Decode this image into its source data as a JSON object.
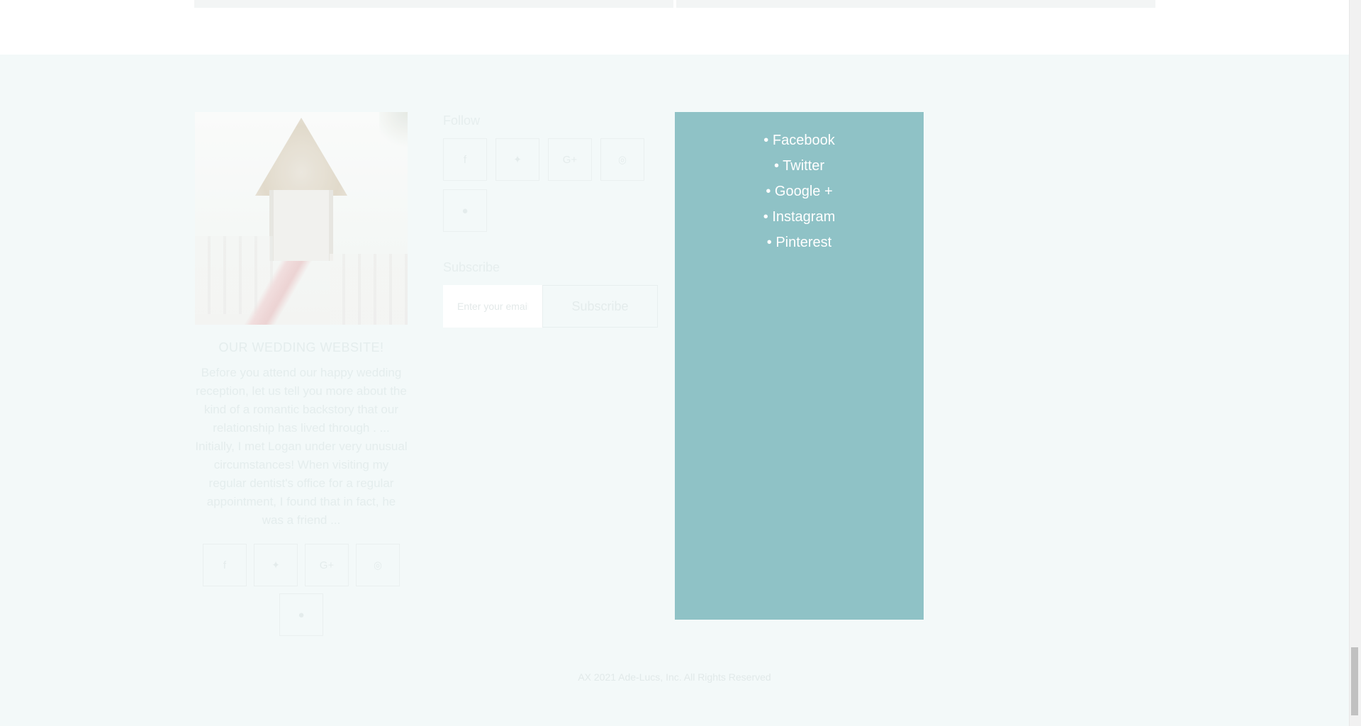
{
  "about": {
    "title": "OUR WEDDING WEBSITE!",
    "paragraph_1": "Before you attend our happy wedding reception, let us tell you more about the kind of a romantic backstory that our relationship has lived through . ...",
    "paragraph_2": "Initially, I met Logan under very unusual circumstances! When visiting my regular dentist's office for a regular appointment, I found that in fact, he was a friend ...",
    "social": [
      "facebook-icon",
      "twitter-icon",
      "google-plus-icon",
      "instagram-icon",
      "pinterest-icon"
    ]
  },
  "follow_widget": {
    "title": "Follow",
    "social": [
      "facebook-icon",
      "twitter-icon",
      "google-plus-icon",
      "instagram-icon",
      "pinterest-icon"
    ]
  },
  "subscribe_widget": {
    "title": "Subscribe",
    "placeholder": "Enter your email",
    "button_label": "Subscribe"
  },
  "follow_list": {
    "items": [
      "Facebook",
      "Twitter",
      "Google +",
      "Instagram",
      "Pinterest"
    ],
    "background": "#8fc2c6"
  },
  "footer": {
    "copyright": "AX 2021 Ade-Lucs, Inc. All Rights Reserved"
  },
  "colors": {
    "footer_bg": "#f3f9f9",
    "accent_panel": "#8fc2c6"
  }
}
